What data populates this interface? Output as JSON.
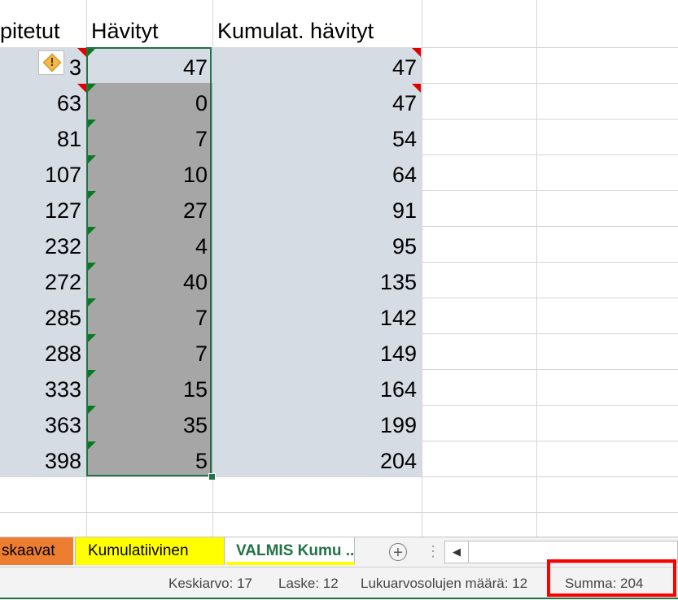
{
  "columns": {
    "a_header": "pitetut",
    "b_header": "Hävityt",
    "c_header": "Kumulat. hävityt"
  },
  "rows": [
    {
      "a": "3",
      "b": "47",
      "c": "47"
    },
    {
      "a": "63",
      "b": "0",
      "c": "47"
    },
    {
      "a": "81",
      "b": "7",
      "c": "54"
    },
    {
      "a": "107",
      "b": "10",
      "c": "64"
    },
    {
      "a": "127",
      "b": "27",
      "c": "91"
    },
    {
      "a": "232",
      "b": "4",
      "c": "95"
    },
    {
      "a": "272",
      "b": "40",
      "c": "135"
    },
    {
      "a": "285",
      "b": "7",
      "c": "142"
    },
    {
      "a": "288",
      "b": "7",
      "c": "149"
    },
    {
      "a": "333",
      "b": "15",
      "c": "164"
    },
    {
      "a": "363",
      "b": "35",
      "c": "199"
    },
    {
      "a": "398",
      "b": "5",
      "c": "204"
    }
  ],
  "warning_icon": "!",
  "sheet_tabs": [
    {
      "label": "skaavat",
      "color": "#ed7d31"
    },
    {
      "label": "Kumulatiivinen",
      "color": "#ffff00"
    },
    {
      "label": "VALMIS Kumu ...",
      "color": "#217346",
      "active": true
    }
  ],
  "tab_add_icon": "+",
  "tab_separator": "⋮",
  "scroll_left_icon": "◀",
  "status": {
    "average": "Keskiarvo: 17",
    "count": "Laske: 12",
    "numeric_count": "Lukuarvosolujen määrä: 12",
    "sum": "Summa: 204"
  },
  "colors": {
    "selection_border": "#217346",
    "selected_fill": "#a6a6a6",
    "range_fill": "#d6dce4",
    "highlight": "#ff0000"
  }
}
